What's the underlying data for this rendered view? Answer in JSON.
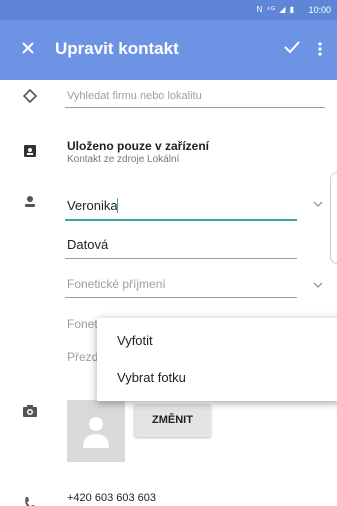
{
  "status_bar": {
    "indicators": "N ⁴ᴳ ◢ ▮",
    "time": "10:00"
  },
  "app_bar": {
    "title": "Upravit kontakt",
    "close_icon": "close-icon",
    "save_icon": "check-icon",
    "more_icon": "more-vert-icon",
    "color": "#6c93e4"
  },
  "company_search": {
    "placeholder": "Vyhledat firmu nebo lokalitu"
  },
  "storage": {
    "title": "Uloženo pouze v zařízení",
    "subtitle": "Kontakt ze zdroje Lokální"
  },
  "name": {
    "first_name": "Veronika",
    "last_name": "Datová",
    "phonetic_last_placeholder": "Fonetické příjmení",
    "phonetic_first_placeholder": "Fonetické křestní jméno",
    "nickname_placeholder": "Přezdívka"
  },
  "photo": {
    "change_label": "ZMĚNIT"
  },
  "phone": {
    "value": "+420 603 603 603"
  },
  "photo_menu": {
    "items": [
      "Vyfotit",
      "Vybrat fotku"
    ]
  },
  "colors": {
    "accent_line": "#3aa99a",
    "status_bar": "#5f86d6"
  }
}
